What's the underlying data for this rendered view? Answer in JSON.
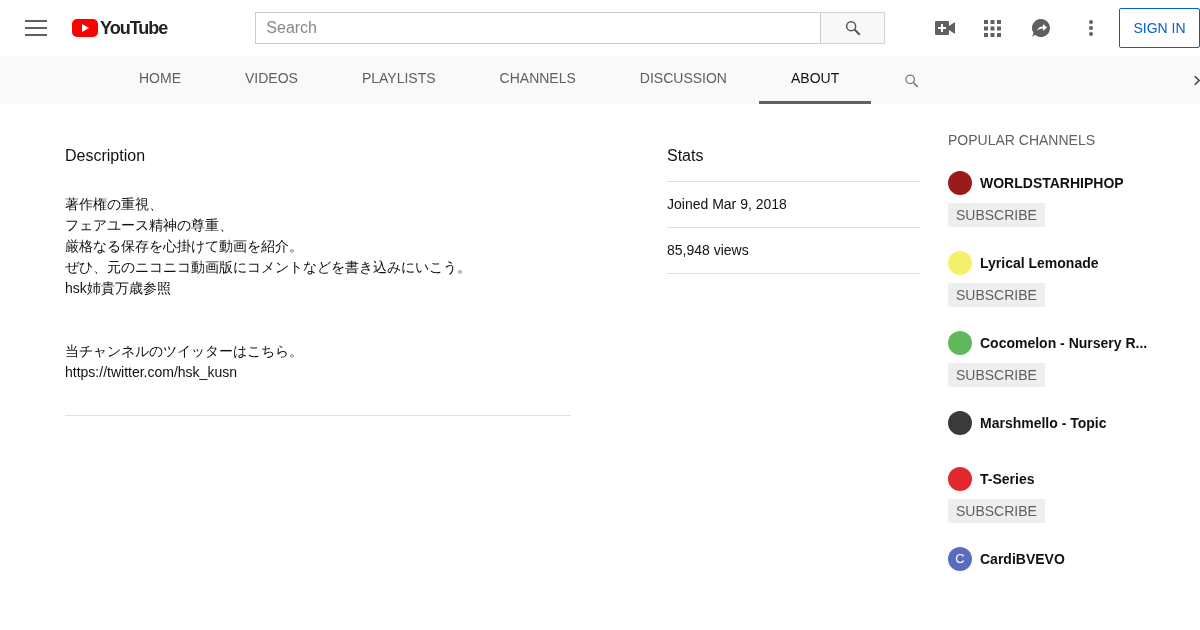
{
  "masthead": {
    "logo": "YouTube",
    "search": {
      "placeholder": "Search"
    },
    "sign_in": "SIGN IN"
  },
  "tabs": [
    {
      "label": "HOME",
      "selected": false
    },
    {
      "label": "VIDEOS",
      "selected": false
    },
    {
      "label": "PLAYLISTS",
      "selected": false
    },
    {
      "label": "CHANNELS",
      "selected": false
    },
    {
      "label": "DISCUSSION",
      "selected": false
    },
    {
      "label": "ABOUT",
      "selected": true
    }
  ],
  "description": {
    "heading": "Description",
    "paragraphs": [
      [
        "著作権の重視、",
        "フェアユース精神の尊重、",
        "厳格なる保存を心掛けて動画を紹介。",
        "ぜひ、元のニコニコ動画版にコメントなどを書き込みにいこう。",
        "hsk姉貴万歳参照"
      ],
      [
        "当チャンネルのツイッターはこちら。",
        "https://twitter.com/hsk_kusn"
      ]
    ]
  },
  "stats": {
    "heading": "Stats",
    "rows": [
      "Joined Mar 9, 2018",
      "85,948 views"
    ]
  },
  "popular_channels": {
    "heading": "POPULAR CHANNELS",
    "items": [
      {
        "name": "WORLDSTARHIPHOP",
        "color": "#9b1b1b",
        "button": "SUBSCRIBE"
      },
      {
        "name": "Lyrical Lemonade",
        "color": "#f5f06a",
        "button": "SUBSCRIBE"
      },
      {
        "name": "Cocomelon - Nursery R...",
        "color": "#5fb85a",
        "button": "SUBSCRIBE"
      },
      {
        "name": "Marshmello - Topic",
        "color": "#3a3a3a"
      },
      {
        "name": "T-Series",
        "color": "#e0282e",
        "button": "SUBSCRIBE"
      },
      {
        "name": "CardiBVEVO",
        "color": "#5c6bc0",
        "initial": "C"
      }
    ]
  }
}
